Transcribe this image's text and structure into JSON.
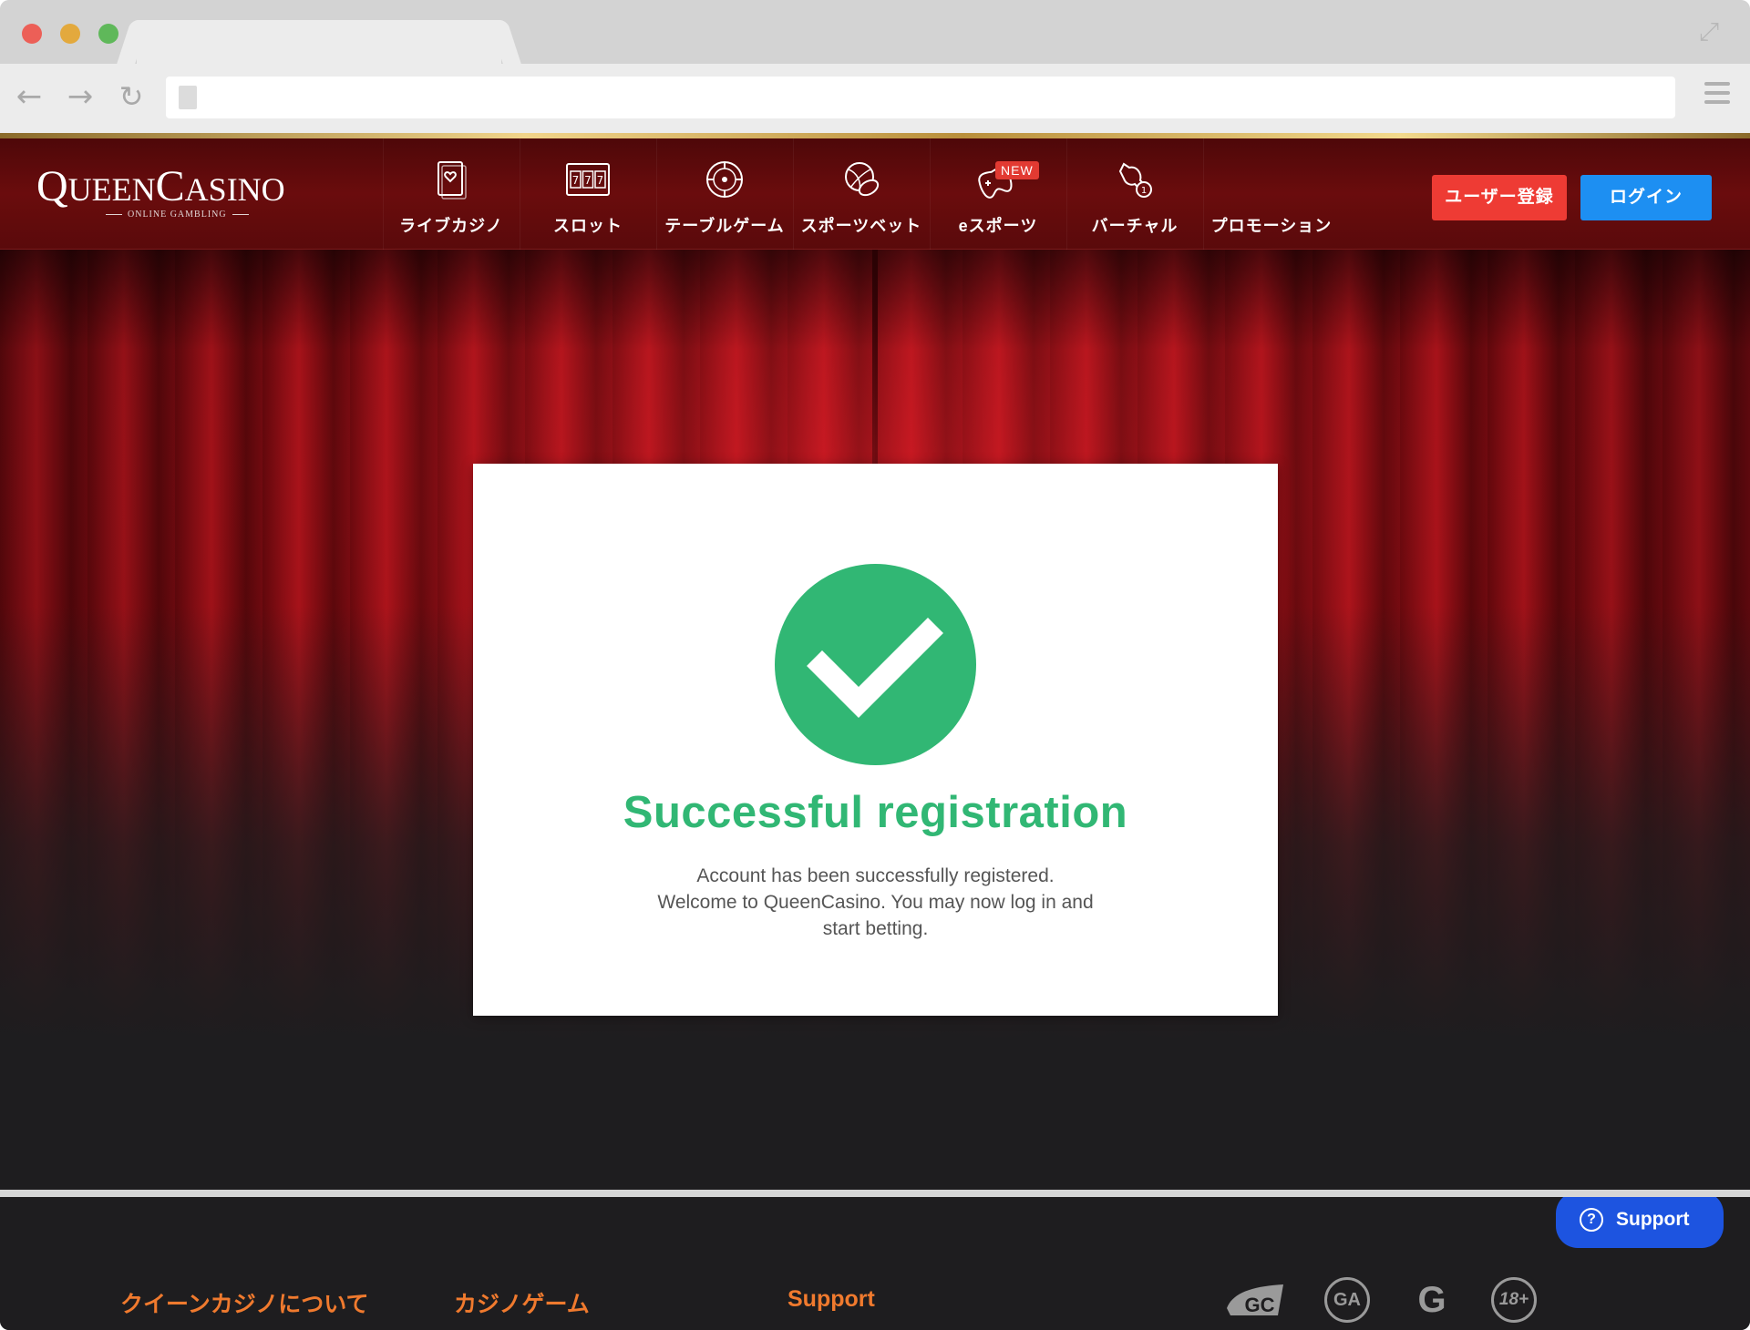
{
  "browser": {
    "url": ""
  },
  "header": {
    "logo": {
      "brand_q": "Q",
      "brand_ueen": "UEEN",
      "brand_c": "C",
      "brand_asino": "ASINO",
      "tagline": "ONLINE GAMBLING"
    },
    "nav": [
      {
        "label": "ライブカジノ",
        "icon": "card-icon"
      },
      {
        "label": "スロット",
        "icon": "slot-machine-icon"
      },
      {
        "label": "テーブルゲーム",
        "icon": "roulette-icon"
      },
      {
        "label": "スポーツベット",
        "icon": "sports-ball-icon"
      },
      {
        "label": "eスポーツ",
        "icon": "gamepad-icon",
        "badge": "NEW"
      },
      {
        "label": "バーチャル",
        "icon": "horse-icon"
      },
      {
        "label": "プロモーション",
        "icon": ""
      }
    ],
    "register_label": "ユーザー登録",
    "login_label": "ログイン"
  },
  "card": {
    "title": "Successful registration",
    "message_line1": "Account has been successfully registered.",
    "message_line2": "Welcome to QueenCasino. You may now log in and",
    "message_line3": "start betting."
  },
  "footer": {
    "links": [
      "クイーンカジノについて",
      "カジノゲーム",
      "Support"
    ],
    "support_button": "Support",
    "logos": [
      "GC",
      "GA",
      "G",
      "18+"
    ]
  },
  "colors": {
    "success_green": "#31b774",
    "register_red": "#ee3b34",
    "login_blue": "#1d8ff2",
    "header_red": "#6a0c0d",
    "footer_orange": "#f07a2e",
    "support_blue": "#1d54e0"
  }
}
